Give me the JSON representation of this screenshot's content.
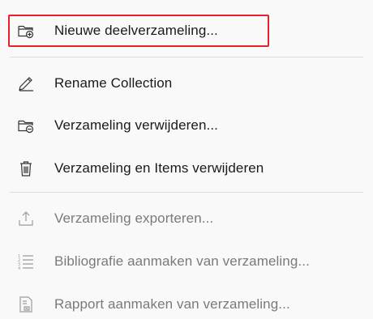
{
  "menu": {
    "items": [
      {
        "label": "Nieuwe deelverzameling...",
        "icon": "folder-add-icon",
        "enabled": true,
        "highlighted": true
      },
      {
        "label": "Rename Collection",
        "icon": "pencil-icon",
        "enabled": true
      },
      {
        "label": "Verzameling verwijderen...",
        "icon": "folder-remove-icon",
        "enabled": true
      },
      {
        "label": "Verzameling en Items verwijderen",
        "icon": "trash-icon",
        "enabled": true
      },
      {
        "label": "Verzameling exporteren...",
        "icon": "export-icon",
        "enabled": false
      },
      {
        "label": "Bibliografie aanmaken van verzameling...",
        "icon": "list-icon",
        "enabled": false
      },
      {
        "label": "Rapport aanmaken van verzameling...",
        "icon": "report-icon",
        "enabled": false
      }
    ]
  },
  "colors": {
    "highlight_border": "#e8202a",
    "background": "#f9f9f9",
    "separator": "#dcdcdc",
    "disabled_text": "#7a7a7a"
  }
}
